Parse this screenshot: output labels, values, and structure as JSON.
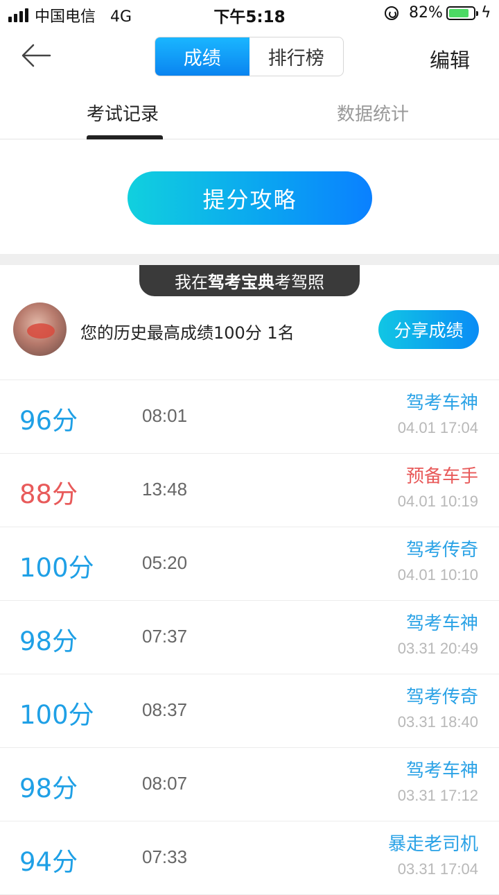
{
  "status_bar": {
    "carrier": "中国电信",
    "network": "4G",
    "time": "下午5:18",
    "battery_percent": "82%",
    "battery_level": 0.82
  },
  "nav": {
    "segments": [
      "成绩",
      "排行榜"
    ],
    "active_segment": 0,
    "edit_label": "编辑"
  },
  "sub_tabs": {
    "items": [
      "考试记录",
      "数据统计"
    ],
    "active": 0
  },
  "tips_button": "提分攻略",
  "banner": {
    "prefix": "我在",
    "brand": "驾考宝典",
    "suffix": "考驾照"
  },
  "best_score": {
    "text": "您的历史最高成绩100分 1名",
    "share_label": "分享成绩"
  },
  "records": [
    {
      "score": "96分",
      "duration": "08:01",
      "title": "驾考车神",
      "date": "04.01 17:04",
      "status": "good"
    },
    {
      "score": "88分",
      "duration": "13:48",
      "title": "预备车手",
      "date": "04.01 10:19",
      "status": "low"
    },
    {
      "score": "100分",
      "duration": "05:20",
      "title": "驾考传奇",
      "date": "04.01 10:10",
      "status": "good"
    },
    {
      "score": "98分",
      "duration": "07:37",
      "title": "驾考车神",
      "date": "03.31 20:49",
      "status": "good"
    },
    {
      "score": "100分",
      "duration": "08:37",
      "title": "驾考传奇",
      "date": "03.31 18:40",
      "status": "good"
    },
    {
      "score": "98分",
      "duration": "08:07",
      "title": "驾考车神",
      "date": "03.31 17:12",
      "status": "good"
    },
    {
      "score": "94分",
      "duration": "07:33",
      "title": "暴走老司机",
      "date": "03.31 17:04",
      "status": "good"
    }
  ],
  "colors": {
    "accent": "#1fa0e6",
    "low_score": "#e85a5a",
    "battery": "#4cd964"
  }
}
